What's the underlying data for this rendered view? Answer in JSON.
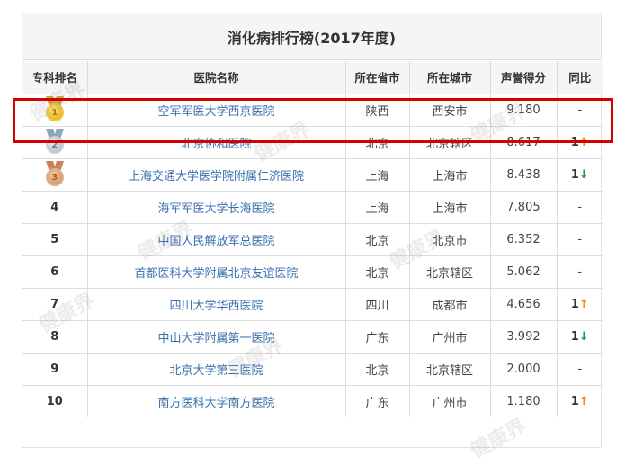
{
  "title": "消化病排行榜(2017年度)",
  "columns": [
    "专科排名",
    "医院名称",
    "所在省市",
    "所在城市",
    "声誉得分",
    "同比"
  ],
  "rows": [
    {
      "rank": "1",
      "medal": "gold",
      "name": "空军军医大学西京医院",
      "province": "陕西",
      "city": "西安市",
      "score": "9.180",
      "yoy": "-",
      "trend": ""
    },
    {
      "rank": "2",
      "medal": "silver",
      "name": "北京协和医院",
      "province": "北京",
      "city": "北京辖区",
      "score": "8.617",
      "yoy": "1",
      "trend": "up"
    },
    {
      "rank": "3",
      "medal": "bronze",
      "name": "上海交通大学医学院附属仁济医院",
      "province": "上海",
      "city": "上海市",
      "score": "8.438",
      "yoy": "1",
      "trend": "down"
    },
    {
      "rank": "4",
      "medal": "",
      "name": "海军军医大学长海医院",
      "province": "上海",
      "city": "上海市",
      "score": "7.805",
      "yoy": "-",
      "trend": ""
    },
    {
      "rank": "5",
      "medal": "",
      "name": "中国人民解放军总医院",
      "province": "北京",
      "city": "北京市",
      "score": "6.352",
      "yoy": "-",
      "trend": ""
    },
    {
      "rank": "6",
      "medal": "",
      "name": "首都医科大学附属北京友谊医院",
      "province": "北京",
      "city": "北京辖区",
      "score": "5.062",
      "yoy": "-",
      "trend": ""
    },
    {
      "rank": "7",
      "medal": "",
      "name": "四川大学华西医院",
      "province": "四川",
      "city": "成都市",
      "score": "4.656",
      "yoy": "1",
      "trend": "up"
    },
    {
      "rank": "8",
      "medal": "",
      "name": "中山大学附属第一医院",
      "province": "广东",
      "city": "广州市",
      "score": "3.992",
      "yoy": "1",
      "trend": "down"
    },
    {
      "rank": "9",
      "medal": "",
      "name": "北京大学第三医院",
      "province": "北京",
      "city": "北京辖区",
      "score": "2.000",
      "yoy": "-",
      "trend": ""
    },
    {
      "rank": "10",
      "medal": "",
      "name": "南方医科大学南方医院",
      "province": "广东",
      "city": "广州市",
      "score": "1.180",
      "yoy": "1",
      "trend": "up"
    }
  ],
  "watermark": "健康界",
  "colors": {
    "link": "#3a70ae",
    "up": "#f08a00",
    "down": "#1e9a3c",
    "highlight": "#d60000",
    "header_bg": "#f5f5f5",
    "border": "#dcdcdc"
  },
  "icons": {
    "up": "arrow-up-icon",
    "down": "arrow-down-icon",
    "medal": "medal-icon"
  }
}
